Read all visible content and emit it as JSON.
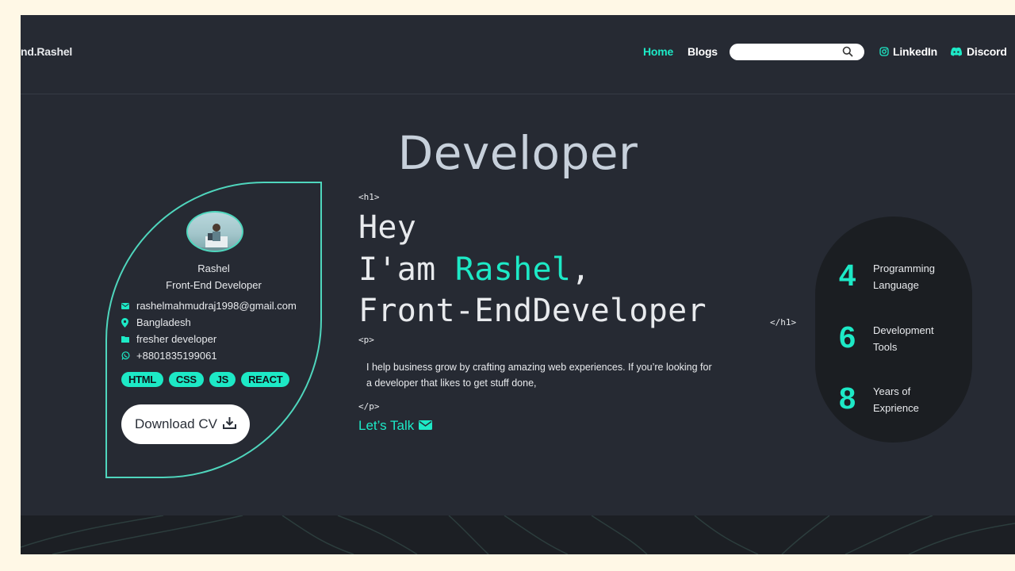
{
  "nav": {
    "brand": "nd.Rashel",
    "links": [
      "Home",
      "Blogs"
    ],
    "search_placeholder": "",
    "social": [
      {
        "label": "LinkedIn",
        "icon": "instagram-icon"
      },
      {
        "label": "Discord",
        "icon": "discord-icon"
      }
    ]
  },
  "hero": {
    "title": "Developer"
  },
  "profile": {
    "name": "Rashel",
    "role": "Front-End Developer",
    "email": "rashelmahmudraj1998@gmail.com",
    "location": "Bangladesh",
    "status": "fresher developer",
    "phone": "+8801835199061",
    "skills": [
      "HTML",
      "CSS",
      "JS",
      "REACT"
    ],
    "download_label": "Download CV"
  },
  "intro": {
    "h1_open": "<h1>",
    "line1": "Hey",
    "line2_prefix": "I'am ",
    "line2_name": "Rashel",
    "line2_suffix": ",",
    "line3": "Front-EndDeveloper",
    "h1_close": "</h1>",
    "p_open": "<p>",
    "paragraph": "I help business grow by crafting amazing web experiences. If you’re looking for a developer that likes to get stuff done,",
    "p_close": "</p>",
    "cta": "Let’s Talk"
  },
  "stats": [
    {
      "number": "4",
      "line1": "Programming",
      "line2": "Language"
    },
    {
      "number": "6",
      "line1": "Development",
      "line2": "Tools"
    },
    {
      "number": "8",
      "line1": "Years of",
      "line2": "Exprience"
    }
  ],
  "colors": {
    "accent": "#1de9c6",
    "background": "#262a33",
    "page": "#fff8e6"
  }
}
